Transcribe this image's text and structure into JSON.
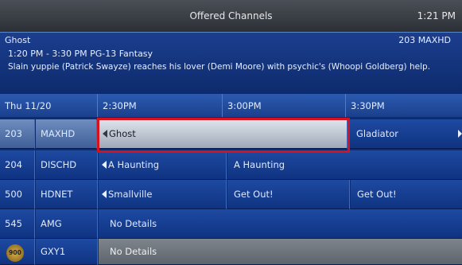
{
  "header": {
    "title": "Offered Channels",
    "clock": "1:21 PM"
  },
  "info": {
    "program_title": "Ghost",
    "channel": "203 MAXHD",
    "meta": "1:20 PM - 3:30 PM   PG-13  Fantasy",
    "description": "Slain yuppie (Patrick Swayze) reaches his lover (Demi Moore) with psychic's (Whoopi Goldberg) help."
  },
  "grid_header": {
    "date": "Thu 11/20",
    "times": [
      "2:30PM",
      "3:00PM",
      "3:30PM"
    ]
  },
  "rows": [
    {
      "number": "203",
      "name": "MAXHD",
      "programs": [
        "Ghost",
        "Gladiator"
      ]
    },
    {
      "number": "204",
      "name": "DISCHD",
      "programs": [
        "A Haunting",
        "A Haunting"
      ]
    },
    {
      "number": "500",
      "name": "HDNET",
      "programs": [
        "Smallville",
        "Get Out!",
        "Get Out!"
      ]
    },
    {
      "number": "545",
      "name": "AMG",
      "programs": [
        "No Details"
      ]
    },
    {
      "number": "900",
      "name": "GXY1",
      "programs": [
        "No Details"
      ]
    }
  ],
  "colors": {
    "selection_outline": "#d5121d",
    "background": "#0c2d72"
  },
  "icons": {
    "continues_left": "triangle-left-icon",
    "continues_right": "triangle-right-icon",
    "logo": "gold-seal-logo"
  }
}
